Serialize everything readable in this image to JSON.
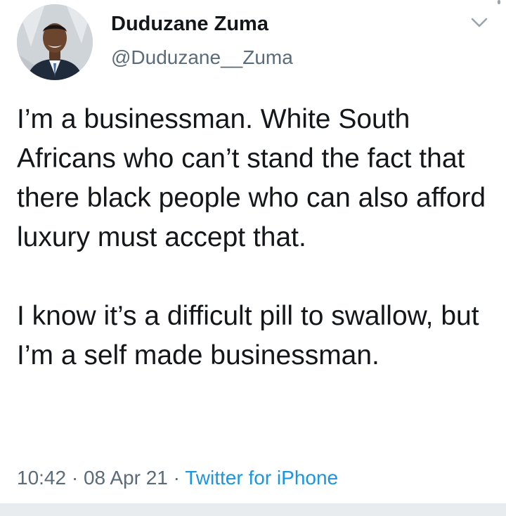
{
  "user": {
    "display_name": "Duduzane Zuma",
    "handle": "@Duduzane__Zuma",
    "avatar_icon": "profile-photo"
  },
  "tweet": {
    "paragraphs": [
      "I’m a businessman. White South Africans who can’t stand the fact that there black people who can also afford luxury must accept that.",
      "I know it’s a difficult pill to swallow, but I’m a self made businessman."
    ],
    "time": "10:42",
    "date": "08 Apr 21",
    "separator": "·",
    "source": "Twitter for iPhone"
  },
  "icons": {
    "menu": "chevron-down-icon"
  },
  "colors": {
    "text": "#14171a",
    "secondary": "#5b6b78",
    "link": "#1b95e0",
    "background": "#ffffff"
  }
}
